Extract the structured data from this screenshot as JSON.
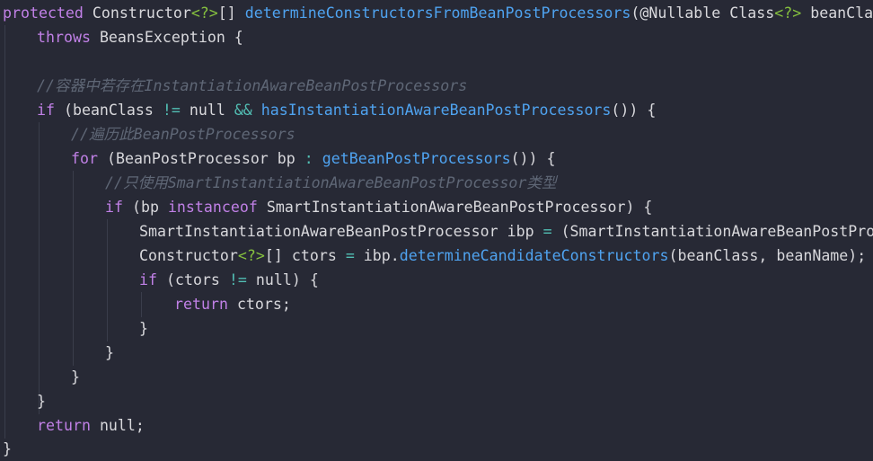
{
  "colors": {
    "background": "#272935",
    "keyword": "#c080e6",
    "function": "#4fa3f0",
    "operator": "#52bfb4",
    "generic": "#86c13f",
    "comment": "#5f6776",
    "text": "#d8d8dc"
  },
  "code": {
    "l1": {
      "kw_protected": "protected",
      "t1": " Constructor",
      "gen1": "<?>",
      "t2": "[] ",
      "fn1": "determineConstructorsFromBeanPostProcessors",
      "t3": "(@Nullable Class",
      "gen2": "<?>",
      "t4": " beanClass,"
    },
    "l2": {
      "kw_throws": "throws",
      "t1": " BeansException {"
    },
    "l3": {
      "comment": "//容器中若存在InstantiationAwareBeanPostProcessors"
    },
    "l4": {
      "kw_if": "if",
      "t1": " (beanClass ",
      "op1": "!=",
      "t2": " null ",
      "op2": "&&",
      "t3": " ",
      "fn1": "hasInstantiationAwareBeanPostProcessors",
      "t4": "()) {"
    },
    "l5": {
      "comment": "//遍历此BeanPostProcessors"
    },
    "l6": {
      "kw_for": "for",
      "t1": " (BeanPostProcessor bp ",
      "op1": ":",
      "t2": " ",
      "fn1": "getBeanPostProcessors",
      "t3": "()) {"
    },
    "l7": {
      "comment": "//只使用SmartInstantiationAwareBeanPostProcessor类型"
    },
    "l8": {
      "kw_if": "if",
      "t1": " (bp ",
      "kw_instanceof": "instanceof",
      "t2": " SmartInstantiationAwareBeanPostProcessor) {"
    },
    "l9": {
      "t1": "SmartInstantiationAwareBeanPostProcessor ibp ",
      "op1": "=",
      "t2": " (SmartInstantiationAwareBeanPostProcess"
    },
    "l10": {
      "t1": "Constructor",
      "gen1": "<?>",
      "t2": "[] ctors ",
      "op1": "=",
      "t3": " ibp.",
      "fn1": "determineCandidateConstructors",
      "t4": "(beanClass, beanName);"
    },
    "l11": {
      "kw_if": "if",
      "t1": " (ctors ",
      "op1": "!=",
      "t2": " null) {"
    },
    "l12": {
      "kw_return": "return",
      "t1": " ctors;"
    },
    "l13": {
      "t1": "}"
    },
    "l14": {
      "t1": "}"
    },
    "l15": {
      "t1": "}"
    },
    "l16": {
      "t1": "}"
    },
    "l17": {
      "kw_return": "return",
      "t1": " null;"
    },
    "l18": {
      "t1": "}"
    }
  }
}
